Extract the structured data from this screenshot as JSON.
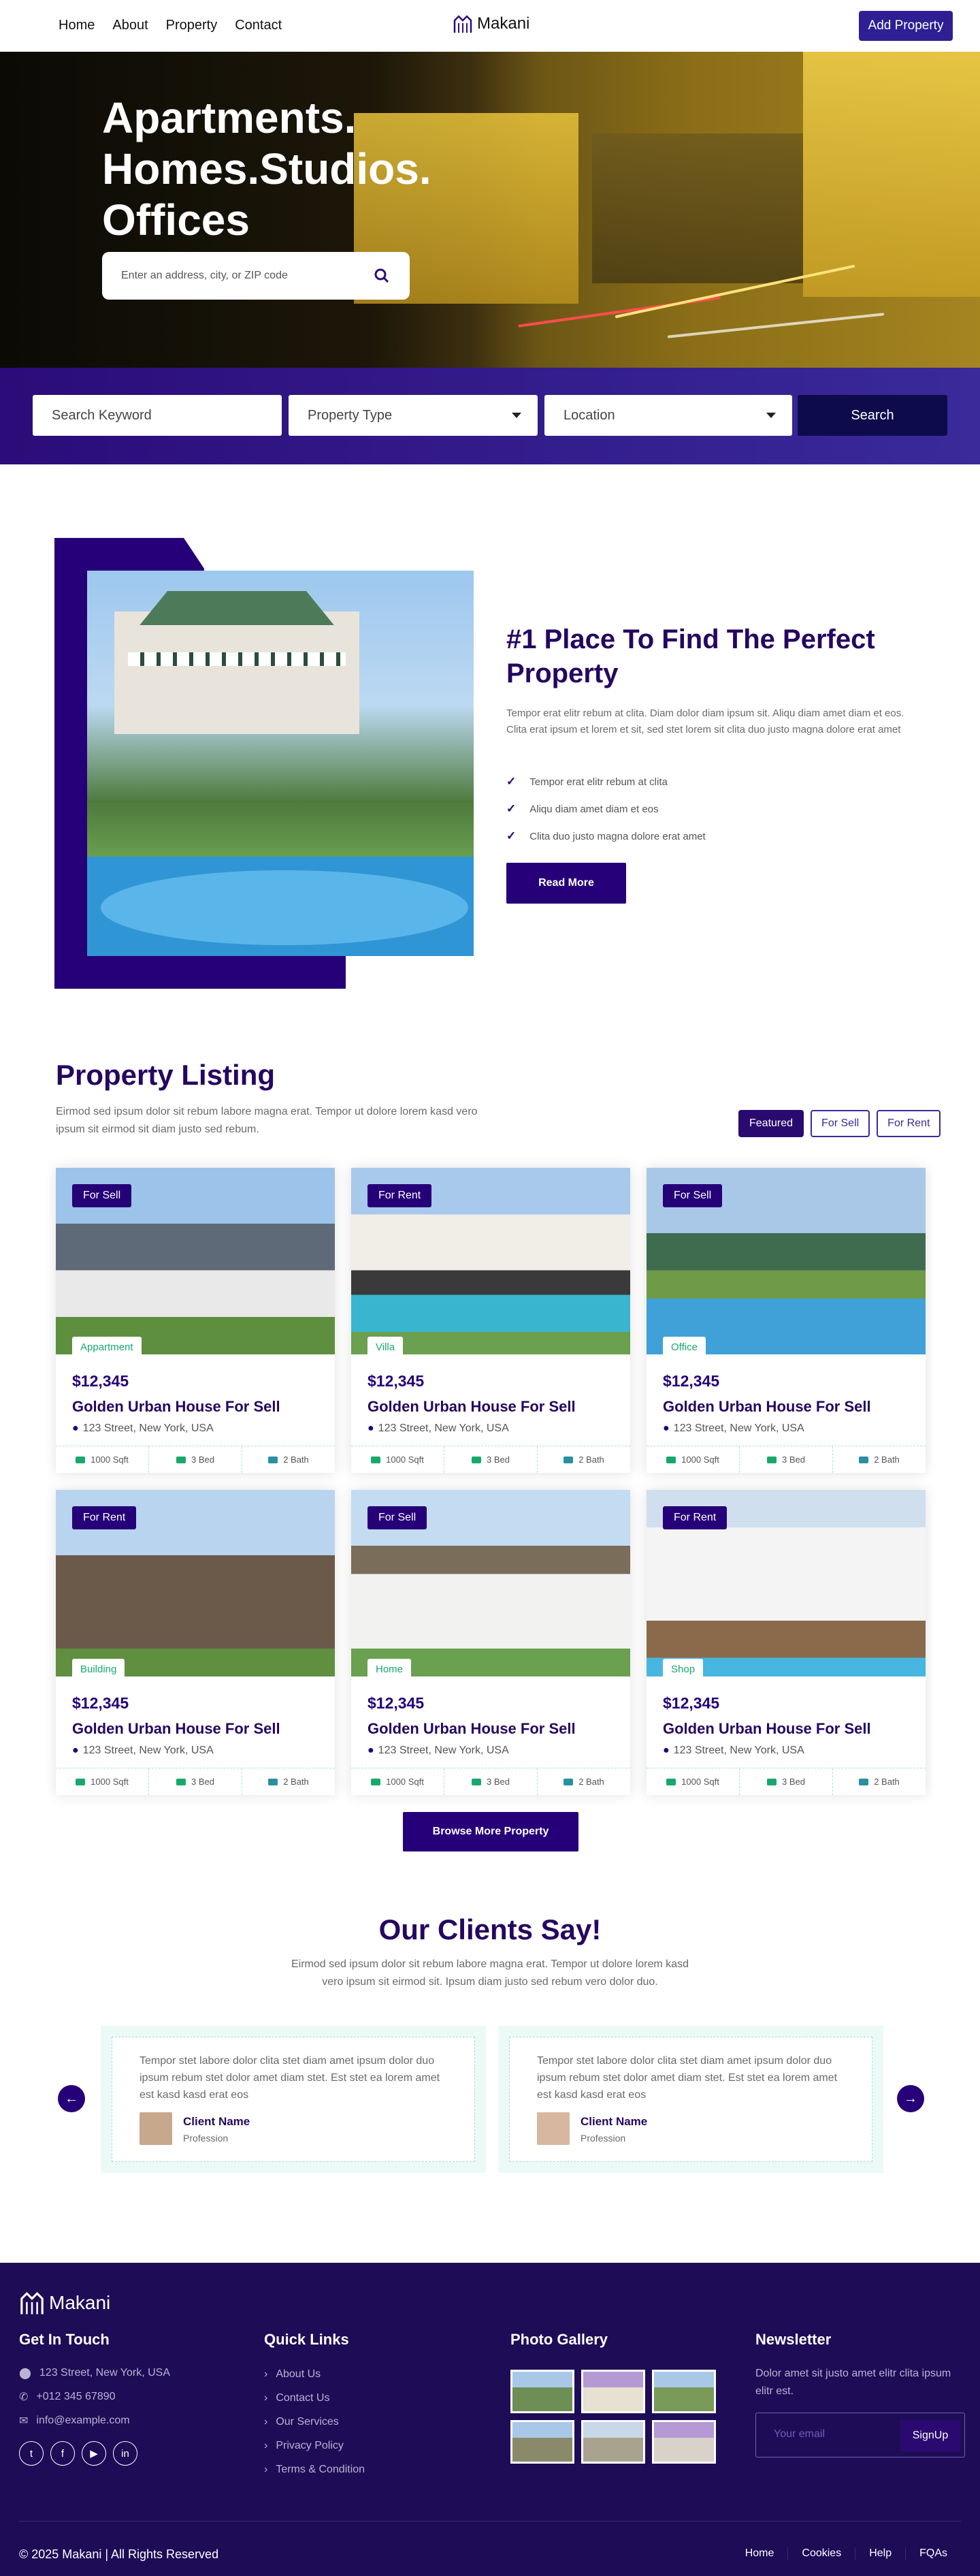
{
  "nav": {
    "links": [
      "Home",
      "About",
      "Property",
      "Contact"
    ],
    "brand": "Makani",
    "add_property": "Add Property"
  },
  "hero": {
    "title_lines": [
      "Apartments.",
      "Homes.Studios.",
      "Offices"
    ],
    "search_placeholder": "Enter an address, city, or ZIP code"
  },
  "filter": {
    "keyword": "Search Keyword",
    "type": "Property Type",
    "location": "Location",
    "search": "Search"
  },
  "about": {
    "title": "#1 Place To Find The Perfect Property",
    "text": "Tempor erat elitr rebum at clita. Diam dolor diam ipsum sit. Aliqu diam amet diam et eos. Clita erat ipsum et lorem et sit, sed stet lorem sit clita duo justo magna dolore erat amet",
    "checks": [
      "Tempor erat elitr rebum at clita",
      "Aliqu diam amet diam et eos",
      "Clita duo justo magna dolore erat amet"
    ],
    "button": "Read More"
  },
  "listing": {
    "title": "Property Listing",
    "subtitle": "Eirmod sed ipsum dolor sit rebum labore magna erat. Tempor ut dolore lorem kasd vero ipsum sit eirmod sit diam justo sed rebum.",
    "tabs": [
      "Featured",
      "For Sell",
      "For Rent"
    ],
    "cards": [
      {
        "badge": "For Sell",
        "type": "Appartment",
        "price": "$12,345",
        "name": "Golden Urban House For Sell",
        "address": "123 Street, New York, USA",
        "sqft": "1000 Sqft",
        "bed": "3 Bed",
        "bath": "2 Bath"
      },
      {
        "badge": "For Rent",
        "type": "Villa",
        "price": "$12,345",
        "name": "Golden Urban House For Sell",
        "address": "123 Street, New York, USA",
        "sqft": "1000 Sqft",
        "bed": "3 Bed",
        "bath": "2 Bath"
      },
      {
        "badge": "For Sell",
        "type": "Office",
        "price": "$12,345",
        "name": "Golden Urban House For Sell",
        "address": "123 Street, New York, USA",
        "sqft": "1000 Sqft",
        "bed": "3 Bed",
        "bath": "2 Bath"
      },
      {
        "badge": "For Rent",
        "type": "Building",
        "price": "$12,345",
        "name": "Golden Urban House For Sell",
        "address": "123 Street, New York, USA",
        "sqft": "1000 Sqft",
        "bed": "3 Bed",
        "bath": "2 Bath"
      },
      {
        "badge": "For Sell",
        "type": "Home",
        "price": "$12,345",
        "name": "Golden Urban House For Sell",
        "address": "123 Street, New York, USA",
        "sqft": "1000 Sqft",
        "bed": "3 Bed",
        "bath": "2 Bath"
      },
      {
        "badge": "For Rent",
        "type": "Shop",
        "price": "$12,345",
        "name": "Golden Urban House For Sell",
        "address": "123 Street, New York, USA",
        "sqft": "1000 Sqft",
        "bed": "3 Bed",
        "bath": "2 Bath"
      }
    ],
    "browse": "Browse More Property"
  },
  "testimonials": {
    "title": "Our Clients Say!",
    "subtitle": "Eirmod sed ipsum dolor sit rebum labore magna erat. Tempor ut dolore lorem kasd vero ipsum sit eirmod sit. Ipsum diam justo sed rebum vero dolor duo.",
    "items": [
      {
        "quote": "Tempor stet labore dolor clita stet diam amet ipsum dolor duo ipsum rebum stet dolor amet diam stet. Est stet ea lorem amet est kasd kasd erat eos",
        "name": "Client Name",
        "profession": "Profession"
      },
      {
        "quote": "Tempor stet labore dolor clita stet diam amet ipsum dolor duo ipsum rebum stet dolor amet diam stet. Est stet ea lorem amet est kasd kasd erat eos",
        "name": "Client Name",
        "profession": "Profession"
      }
    ]
  },
  "footer": {
    "brand": "Makani",
    "touch_title": "Get In Touch",
    "address": "123 Street, New York, USA",
    "phone": "+012 345 67890",
    "email": "info@example.com",
    "links_title": "Quick Links",
    "links": [
      "About Us",
      "Contact Us",
      "Our Services",
      "Privacy Policy",
      "Terms & Condition"
    ],
    "gallery_title": "Photo Gallery",
    "newsletter_title": "Newsletter",
    "newsletter_text": "Dolor amet sit justo amet elitr clita ipsum elitr est.",
    "email_placeholder": "Your email",
    "signup": "SignUp",
    "copyright": "© 2025 Makani | All Rights Reserved",
    "bottom_links": [
      "Home",
      "Cookies",
      "Help",
      "FQAs"
    ]
  },
  "colors": {
    "primary": "#260078",
    "accent": "#19a86c",
    "footer_bg": "#1e0c57"
  }
}
